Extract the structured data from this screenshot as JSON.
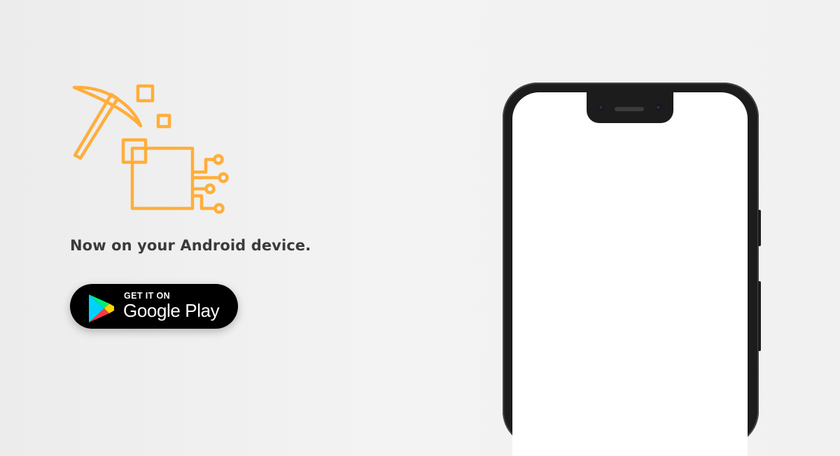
{
  "tagline": "Now on your Android device.",
  "store_badge": {
    "small_label": "GET IT ON",
    "large_label": "Google Play"
  },
  "icons": {
    "logo": "pickaxe-circuit-icon",
    "play": "google-play-icon"
  },
  "colors": {
    "brand": "#ffae3b",
    "background": "#f1f1f1",
    "text": "#3b3b3b",
    "badge": "#000000"
  }
}
